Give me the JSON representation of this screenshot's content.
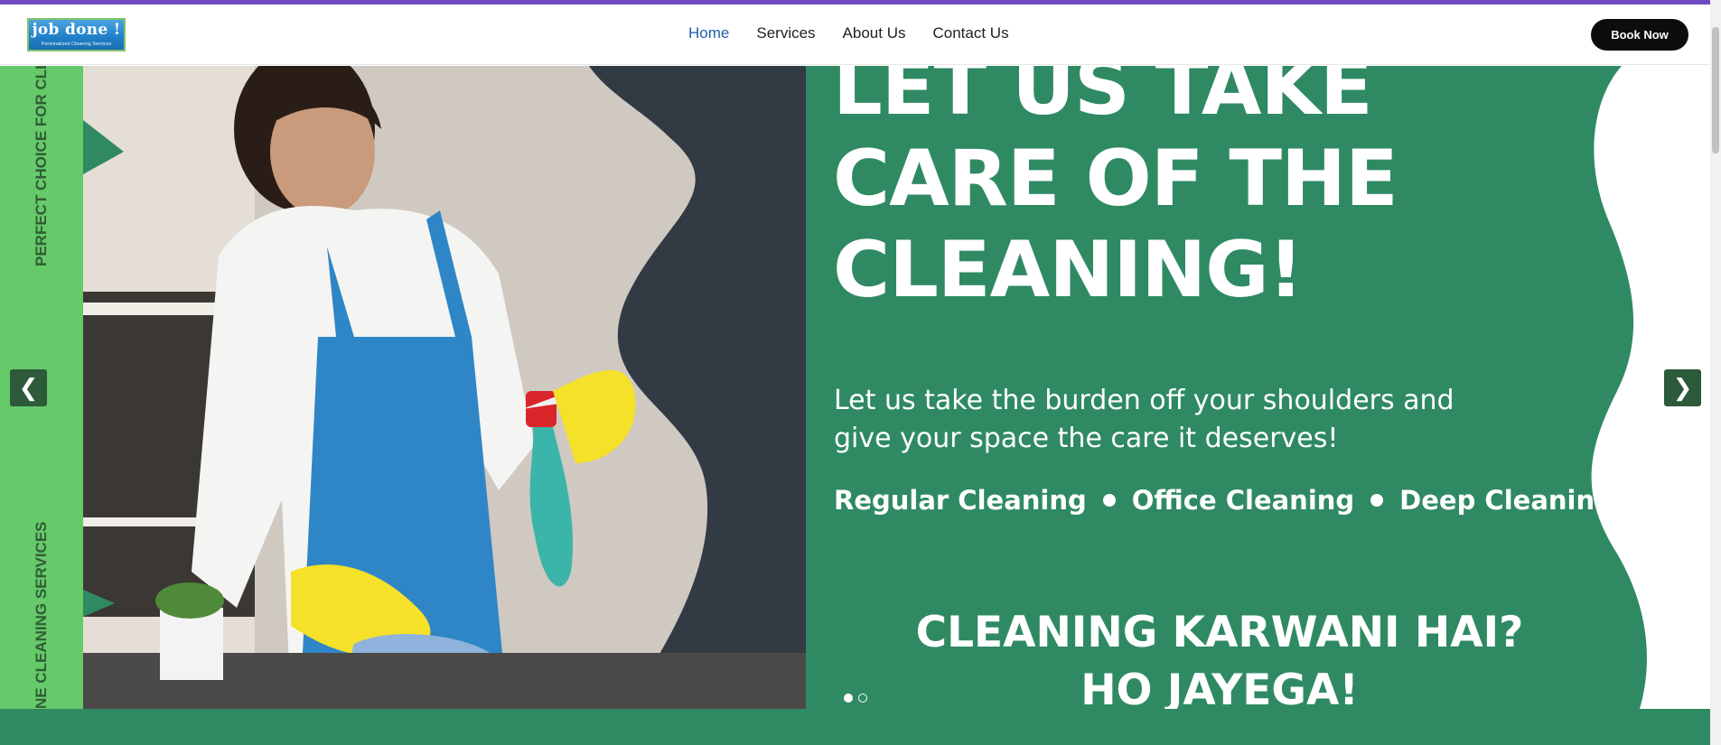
{
  "brand": {
    "logo_main": "job done !",
    "logo_sub": "Personalized Cleaning Services"
  },
  "nav": {
    "items": [
      "Home",
      "Services",
      "About Us",
      "Contact Us"
    ],
    "active": "Home"
  },
  "header": {
    "book_label": "Book Now"
  },
  "hero": {
    "headline_lines": [
      "LET US TAKE",
      "CARE OF THE",
      "CLEANING!"
    ],
    "tagline_lines": [
      "Let us take the burden off your shoulders and",
      "give your space the care it deserves!"
    ],
    "services": [
      "Regular Cleaning",
      "Office Cleaning",
      "Deep Cleaning"
    ],
    "cta_lines": [
      "CLEANING KARWANI HAI?",
      "HO JAYEGA!"
    ],
    "side_text_top": "PERFECT CHOICE FOR CLI",
    "side_text_bottom": "NE CLEANING SERVICES",
    "slides_total": 2,
    "slide_active": 1
  },
  "colors": {
    "hero_green": "#2f8a63",
    "strip_green": "#66c96a",
    "nav_active": "#1f5fa8",
    "top_bar": "#6f4bbf"
  },
  "icons": {
    "prev": "chevron-left-icon",
    "next": "chevron-right-icon"
  }
}
